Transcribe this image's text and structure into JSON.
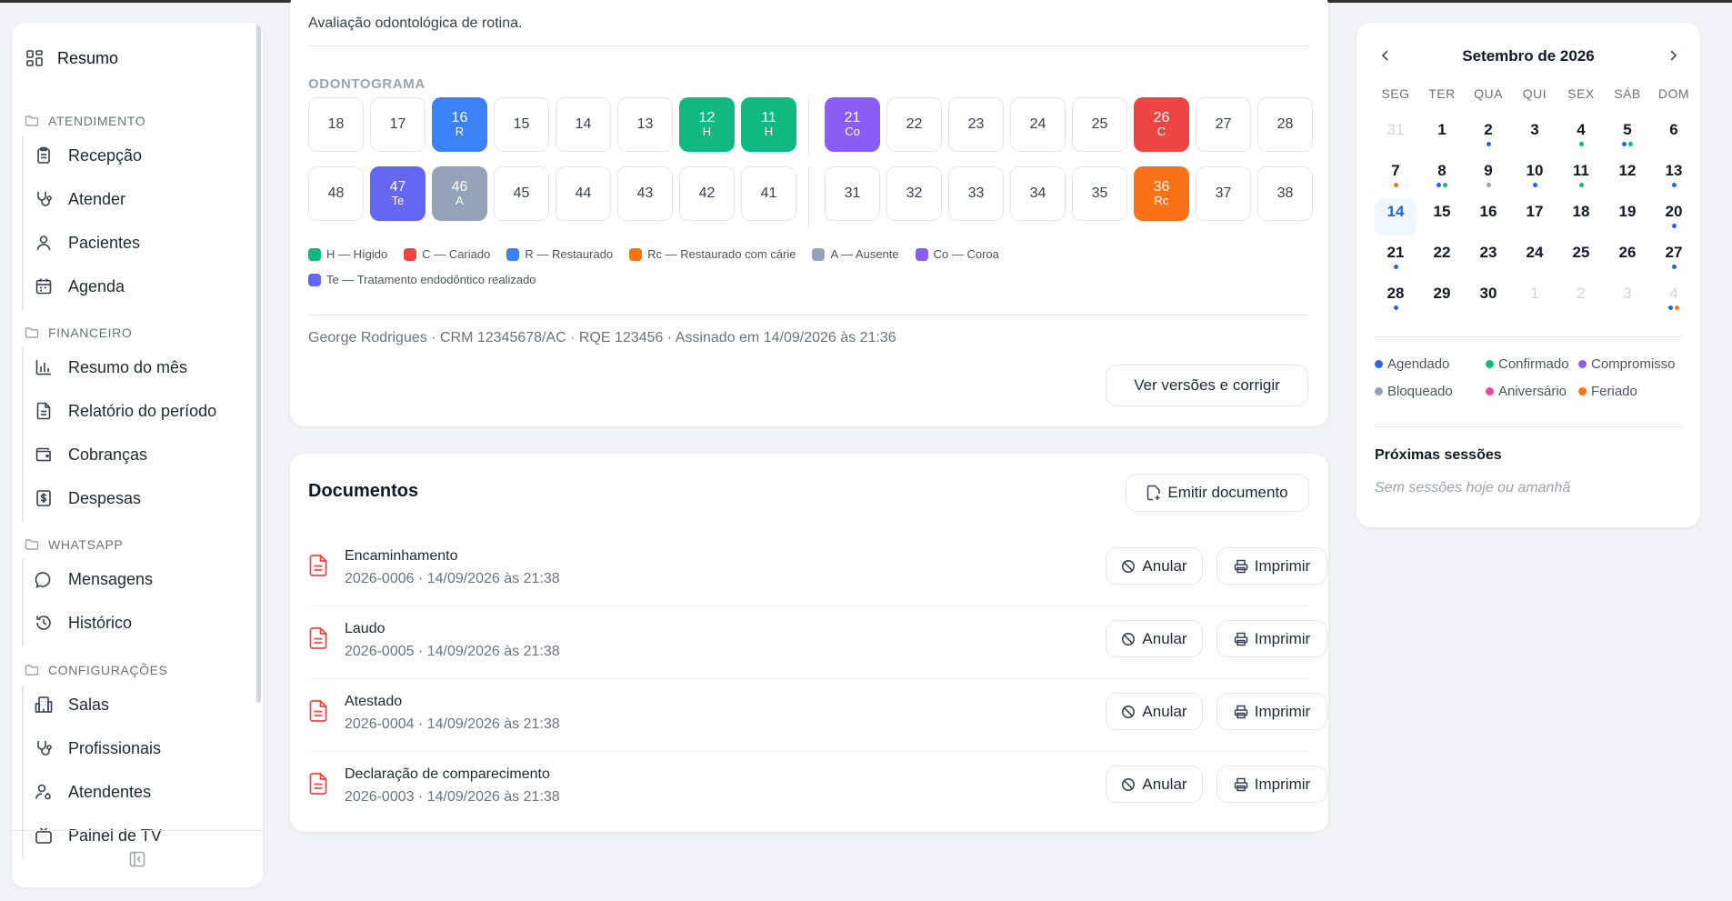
{
  "sidebar": {
    "resumo": "Resumo",
    "sections": [
      {
        "title": "ATENDIMENTO",
        "items": [
          "Recepção",
          "Atender",
          "Pacientes",
          "Agenda"
        ]
      },
      {
        "title": "FINANCEIRO",
        "items": [
          "Resumo do mês",
          "Relatório do período",
          "Cobranças",
          "Despesas"
        ]
      },
      {
        "title": "WHATSAPP",
        "items": [
          "Mensagens",
          "Histórico"
        ]
      },
      {
        "title": "CONFIGURAÇÕES",
        "items": [
          "Salas",
          "Profissionais",
          "Atendentes",
          "Painel de TV"
        ]
      }
    ]
  },
  "record": {
    "note": "Avaliação odontológica de rotina.",
    "odontogram_title": "ODONTOGRAMA",
    "upper_teeth": [
      {
        "n": "18",
        "c": ""
      },
      {
        "n": "17",
        "c": ""
      },
      {
        "n": "16",
        "c": "R"
      },
      {
        "n": "15",
        "c": ""
      },
      {
        "n": "14",
        "c": ""
      },
      {
        "n": "13",
        "c": ""
      },
      {
        "n": "12",
        "c": "H"
      },
      {
        "n": "11",
        "c": "H"
      },
      {
        "n": "21",
        "c": "Co"
      },
      {
        "n": "22",
        "c": ""
      },
      {
        "n": "23",
        "c": ""
      },
      {
        "n": "24",
        "c": ""
      },
      {
        "n": "25",
        "c": ""
      },
      {
        "n": "26",
        "c": "C"
      },
      {
        "n": "27",
        "c": ""
      },
      {
        "n": "28",
        "c": ""
      }
    ],
    "lower_teeth": [
      {
        "n": "48",
        "c": ""
      },
      {
        "n": "47",
        "c": "Te"
      },
      {
        "n": "46",
        "c": "A"
      },
      {
        "n": "45",
        "c": ""
      },
      {
        "n": "44",
        "c": ""
      },
      {
        "n": "43",
        "c": ""
      },
      {
        "n": "42",
        "c": ""
      },
      {
        "n": "41",
        "c": ""
      },
      {
        "n": "31",
        "c": ""
      },
      {
        "n": "32",
        "c": ""
      },
      {
        "n": "33",
        "c": ""
      },
      {
        "n": "34",
        "c": ""
      },
      {
        "n": "35",
        "c": ""
      },
      {
        "n": "36",
        "c": "Rc"
      },
      {
        "n": "37",
        "c": ""
      },
      {
        "n": "38",
        "c": ""
      }
    ],
    "legend": [
      {
        "code": "H",
        "label": "H — Hígido",
        "color": "#10b981"
      },
      {
        "code": "C",
        "label": "C — Cariado",
        "color": "#ef4444"
      },
      {
        "code": "R",
        "label": "R — Restaurado",
        "color": "#3b82f6"
      },
      {
        "code": "Rc",
        "label": "Rc — Restaurado com cárie",
        "color": "#f97316"
      },
      {
        "code": "A",
        "label": "A — Ausente",
        "color": "#94a3b8"
      },
      {
        "code": "Co",
        "label": "Co — Coroa",
        "color": "#8b5cf6"
      },
      {
        "code": "Te",
        "label": "Te — Tratamento endodôntico realizado",
        "color": "#6366f1"
      }
    ],
    "signature": "George Rodrigues · CRM 12345678/AC · RQE 123456 · Assinado em 14/09/2026 às 21:36",
    "versions_button": "Ver versões e corrigir"
  },
  "documents": {
    "title": "Documentos",
    "emit_button": "Emitir documento",
    "void_label": "Anular",
    "print_label": "Imprimir",
    "items": [
      {
        "name": "Encaminhamento",
        "meta": "2026-0006 · 14/09/2026 às 21:38"
      },
      {
        "name": "Laudo",
        "meta": "2026-0005 · 14/09/2026 às 21:38"
      },
      {
        "name": "Atestado",
        "meta": "2026-0004 · 14/09/2026 às 21:38"
      },
      {
        "name": "Declaração de comparecimento",
        "meta": "2026-0003 · 14/09/2026 às 21:38"
      }
    ]
  },
  "calendar": {
    "title": "Setembro de 2026",
    "weekdays": [
      "SEG",
      "TER",
      "QUA",
      "QUI",
      "SEX",
      "SÁB",
      "DOM"
    ],
    "today": "14",
    "weeks": [
      [
        {
          "d": "31",
          "m": true
        },
        {
          "d": "1"
        },
        {
          "d": "2",
          "dots": [
            "agendado"
          ]
        },
        {
          "d": "3"
        },
        {
          "d": "4",
          "dots": [
            "confirmado"
          ]
        },
        {
          "d": "5",
          "dots": [
            "agendado",
            "confirmado"
          ]
        },
        {
          "d": "6"
        }
      ],
      [
        {
          "d": "7",
          "dots": [
            "feriado"
          ]
        },
        {
          "d": "8",
          "dots": [
            "agendado",
            "confirmado"
          ]
        },
        {
          "d": "9",
          "dots": [
            "bloqueado"
          ]
        },
        {
          "d": "10",
          "dots": [
            "agendado"
          ]
        },
        {
          "d": "11",
          "dots": [
            "confirmado"
          ]
        },
        {
          "d": "12"
        },
        {
          "d": "13",
          "dots": [
            "agendado"
          ]
        }
      ],
      [
        {
          "d": "14"
        },
        {
          "d": "15"
        },
        {
          "d": "16"
        },
        {
          "d": "17"
        },
        {
          "d": "18"
        },
        {
          "d": "19"
        },
        {
          "d": "20",
          "dots": [
            "agendado"
          ]
        }
      ],
      [
        {
          "d": "21",
          "dots": [
            "agendado"
          ]
        },
        {
          "d": "22"
        },
        {
          "d": "23"
        },
        {
          "d": "24"
        },
        {
          "d": "25"
        },
        {
          "d": "26"
        },
        {
          "d": "27",
          "dots": [
            "agendado"
          ]
        }
      ],
      [
        {
          "d": "28",
          "dots": [
            "agendado"
          ]
        },
        {
          "d": "29"
        },
        {
          "d": "30"
        },
        {
          "d": "1",
          "m": true
        },
        {
          "d": "2",
          "m": true
        },
        {
          "d": "3",
          "m": true
        },
        {
          "d": "4",
          "m": true,
          "dots": [
            "agendado",
            "feriado"
          ]
        }
      ]
    ],
    "legend": [
      {
        "key": "agendado",
        "label": "Agendado",
        "color": "#2563eb"
      },
      {
        "key": "confirmado",
        "label": "Confirmado",
        "color": "#10b981"
      },
      {
        "key": "compromisso",
        "label": "Compromisso",
        "color": "#8b5cf6"
      },
      {
        "key": "bloqueado",
        "label": "Bloqueado",
        "color": "#94a3b8"
      },
      {
        "key": "aniversario",
        "label": "Aniversário",
        "color": "#ec4899"
      },
      {
        "key": "feriado",
        "label": "Feriado",
        "color": "#f97316"
      }
    ],
    "next_sessions_title": "Próximas sessões",
    "next_sessions_empty": "Sem sessões hoje ou amanhã"
  }
}
